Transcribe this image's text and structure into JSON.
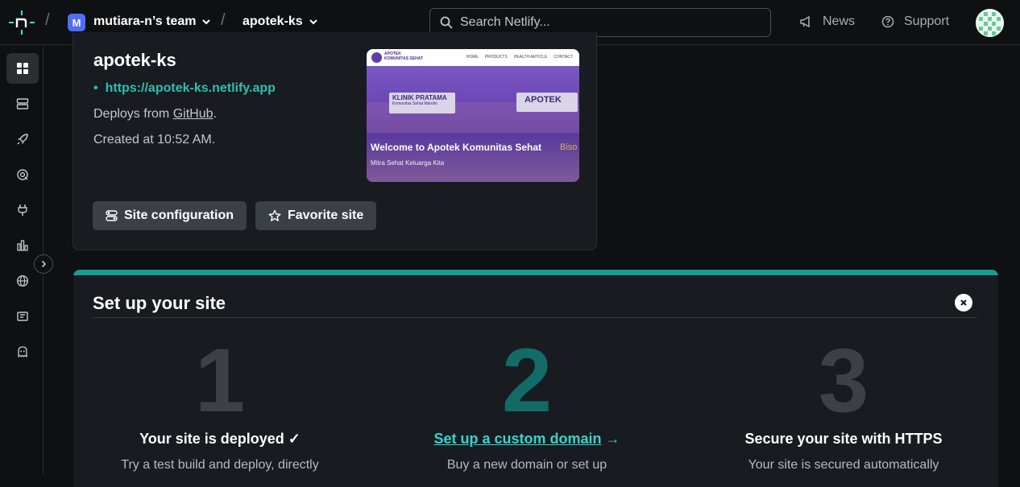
{
  "topbar": {
    "team_initial": "M",
    "team_name": "mutiara-n’s team",
    "site_name": "apotek-ks",
    "search_placeholder": "Search Netlify...",
    "news_label": "News",
    "support_label": "Support"
  },
  "sidebar": {
    "items": [
      "overview-icon",
      "deploys-icon",
      "rocket-icon",
      "logs-icon",
      "plug-icon",
      "analytics-icon",
      "domain-icon",
      "forms-icon",
      "integrations-icon"
    ]
  },
  "site": {
    "title": "apotek-ks",
    "url": "https://apotek-ks.netlify.app",
    "deploys_prefix": "Deploys from ",
    "deploys_source": "GitHub",
    "deploys_suffix": ".",
    "created": "Created at 10:52 AM.",
    "config_button": "Site configuration",
    "favorite_button": "Favorite site",
    "preview": {
      "brand_line1": "APOTEK",
      "brand_line2": "KOMUNITAS SEHAT",
      "nav": [
        "HOME",
        "PRODUCTS",
        "HEALTH ARTICLE",
        "CONTACT"
      ],
      "sign_left_line1": "KLINIK PRATAMA",
      "sign_left_line2": "Komunitas Sehat Mandiri",
      "sign_right": "APOTEK",
      "side_text": "Biso",
      "headline": "Welcome to Apotek Komunitas Sehat",
      "subline": "Mitra Sehat Keluarga Kita"
    }
  },
  "setup": {
    "title": "Set up your site",
    "steps": [
      {
        "number": "1",
        "title": "Your site is deployed ✓",
        "desc": "Try a test build and deploy, directly"
      },
      {
        "number": "2",
        "title": "Set up a custom domain",
        "arrow": "→",
        "desc": "Buy a new domain or set up"
      },
      {
        "number": "3",
        "title": "Secure your site with HTTPS",
        "desc": "Your site is secured automatically"
      }
    ]
  },
  "colors": {
    "accent": "#2dbfb0",
    "link": "#33d6d0",
    "team_avatar": "#4f6df5",
    "background": "#0e1012",
    "card": "#181b1f"
  }
}
